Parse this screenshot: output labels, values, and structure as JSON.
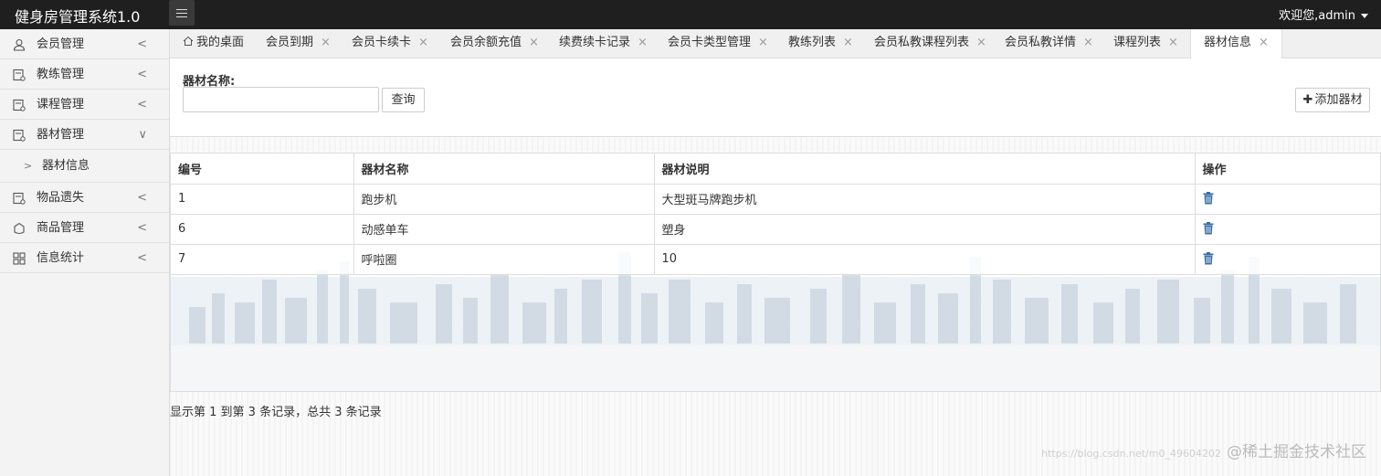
{
  "app": {
    "title": "健身房管理系统1.0",
    "welcome": "欢迎您,admin"
  },
  "sidebar": {
    "items": [
      {
        "label": "会员管理",
        "icon": "user-icon",
        "chevron": "<"
      },
      {
        "label": "教练管理",
        "icon": "card-icon",
        "chevron": "<"
      },
      {
        "label": "课程管理",
        "icon": "card-icon",
        "chevron": "<"
      },
      {
        "label": "器材管理",
        "icon": "card-icon",
        "chevron": "∨"
      },
      {
        "label": "物品遗失",
        "icon": "card-icon",
        "chevron": "<"
      },
      {
        "label": "商品管理",
        "icon": "bag-icon",
        "chevron": "<"
      },
      {
        "label": "信息统计",
        "icon": "grid-icon",
        "chevron": "<"
      }
    ],
    "subitem": {
      "label": "器材信息",
      "chevron": ">"
    }
  },
  "tabs": [
    {
      "label": "我的桌面",
      "home": true
    },
    {
      "label": "会员到期"
    },
    {
      "label": "会员卡续卡"
    },
    {
      "label": "会员余额充值"
    },
    {
      "label": "续费续卡记录"
    },
    {
      "label": "会员卡类型管理"
    },
    {
      "label": "教练列表"
    },
    {
      "label": "会员私教课程列表"
    },
    {
      "label": "会员私教详情"
    },
    {
      "label": "课程列表"
    },
    {
      "label": "器材信息",
      "active": true
    }
  ],
  "close_glyph": "×",
  "search": {
    "label": "器材名称:",
    "value": "",
    "query_button": "查询",
    "add_button": "添加器材",
    "add_plus": "✚"
  },
  "table": {
    "headers": [
      "编号",
      "器材名称",
      "器材说明",
      "操作"
    ],
    "rows": [
      {
        "id": "1",
        "name": "跑步机",
        "desc": "大型斑马牌跑步机"
      },
      {
        "id": "6",
        "name": "动感单车",
        "desc": "塑身"
      },
      {
        "id": "7",
        "name": "呼啦圈",
        "desc": "10"
      }
    ]
  },
  "pagination": {
    "info": "显示第 1 到第 3 条记录，总共 3 条记录"
  },
  "watermark": {
    "url_text": "https://blog.csdn.net/m0_49604202",
    "text": "@稀土掘金技术社区"
  },
  "colors": {
    "topbar": "#1f1f1f",
    "sidebar": "#f3f3f3",
    "icon_blue": "#3a6ea5"
  }
}
